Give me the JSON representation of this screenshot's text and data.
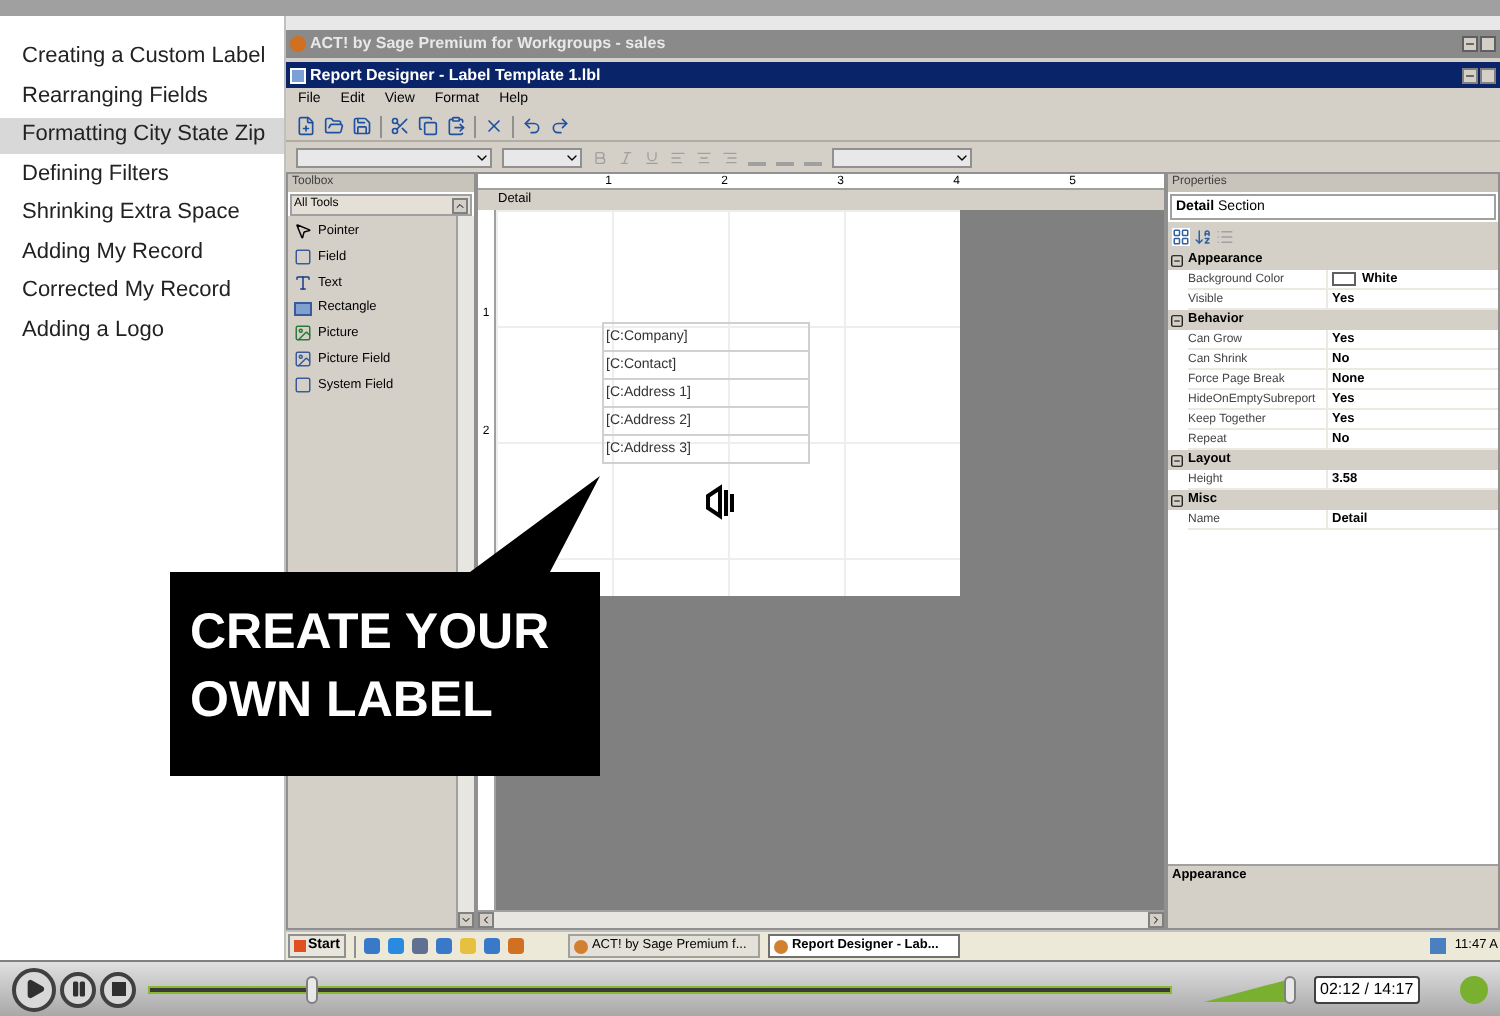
{
  "sidebar": {
    "items": [
      {
        "label": "Creating a Custom Label",
        "selected": false
      },
      {
        "label": "Rearranging Fields",
        "selected": false
      },
      {
        "label": "Formatting City State Zip",
        "selected": true
      },
      {
        "label": "Defining Filters",
        "selected": false
      },
      {
        "label": "Shrinking Extra Space",
        "selected": false
      },
      {
        "label": "Adding My Record",
        "selected": false
      },
      {
        "label": "Corrected My Record",
        "selected": false
      },
      {
        "label": "Adding a Logo",
        "selected": false
      }
    ]
  },
  "app": {
    "title": "ACT! by Sage Premium for Workgroups - sales",
    "document_title": "Report Designer - Label Template 1.lbl",
    "menu": [
      "File",
      "Edit",
      "View",
      "Format",
      "Help"
    ],
    "toolbox": {
      "title": "Toolbox",
      "dropdown": "All Tools",
      "items": [
        {
          "label": "Pointer",
          "kind": "pointer"
        },
        {
          "label": "Field",
          "kind": "field"
        },
        {
          "label": "Text",
          "kind": "text"
        },
        {
          "label": "Rectangle",
          "kind": "rectangle"
        },
        {
          "label": "Picture",
          "kind": "picture"
        },
        {
          "label": "Picture Field",
          "kind": "picture_field"
        },
        {
          "label": "System Field",
          "kind": "field"
        }
      ]
    },
    "designer": {
      "ruler_marks": [
        "1",
        "2",
        "3",
        "4",
        "5"
      ],
      "vertical_marks": [
        "1",
        "2"
      ],
      "section": "Detail",
      "fields": [
        "[C:Company]",
        "[C:Contact]",
        "[C:Address 1]",
        "[C:Address 2]",
        "[C:Address 3]"
      ]
    },
    "properties": {
      "title": "Properties",
      "object": "Detail",
      "object_type": "Section",
      "categories": [
        {
          "name": "Appearance",
          "rows": [
            {
              "name": "Background Color",
              "value": "White",
              "kind": "color"
            },
            {
              "name": "Visible",
              "value": "Yes",
              "kind": "value"
            }
          ]
        },
        {
          "name": "Behavior",
          "rows": [
            {
              "name": "Can Grow",
              "value": "Yes",
              "kind": "value"
            },
            {
              "name": "Can Shrink",
              "value": "No",
              "kind": "value"
            },
            {
              "name": "Force Page Break",
              "value": "None",
              "kind": "value"
            },
            {
              "name": "HideOnEmptySubreport",
              "value": "Yes",
              "kind": "value"
            },
            {
              "name": "Keep Together",
              "value": "Yes",
              "kind": "value"
            },
            {
              "name": "Repeat",
              "value": "No",
              "kind": "value"
            }
          ]
        },
        {
          "name": "Layout",
          "rows": [
            {
              "name": "Height",
              "value": "3.58",
              "kind": "value"
            }
          ]
        },
        {
          "name": "Misc",
          "rows": [
            {
              "name": "Name",
              "value": "Detail",
              "kind": "value"
            }
          ]
        }
      ],
      "description": "Appearance"
    },
    "taskbar": {
      "start": "Start",
      "tasks": [
        {
          "label": "ACT! by Sage Premium f...",
          "selected": false
        },
        {
          "label": "Report Designer - Lab...",
          "selected": true
        }
      ],
      "clock": "11:47 A"
    }
  },
  "callout": {
    "lines": [
      "CREATE YOUR",
      "OWN LABEL"
    ]
  },
  "player": {
    "progress": {
      "level": 0.16
    },
    "volume": {
      "level": 0.95
    },
    "time": "02:12 / 14:17"
  }
}
